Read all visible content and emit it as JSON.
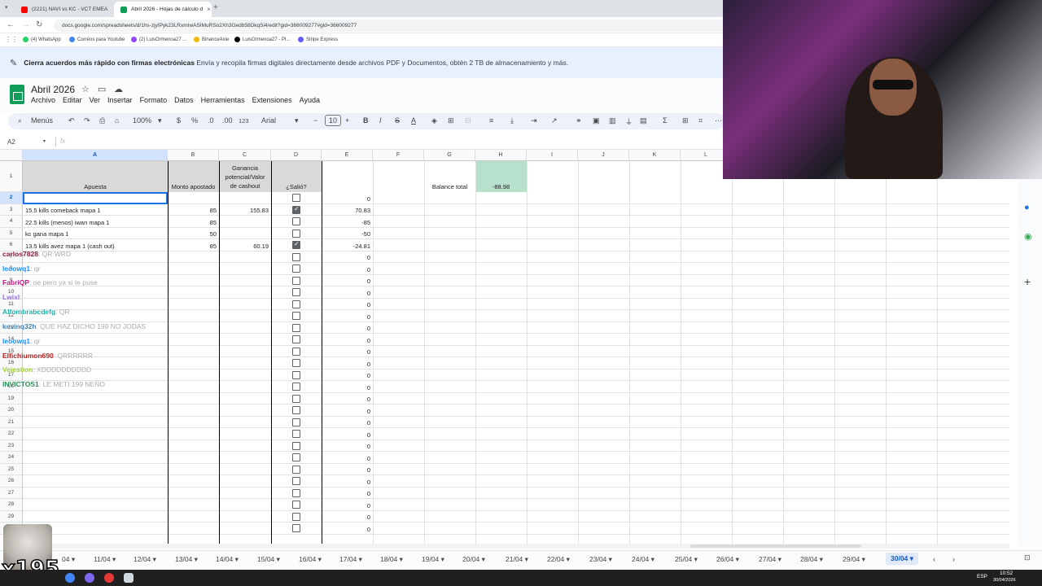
{
  "browser": {
    "tabs": [
      {
        "label": "(2221) NAVI vs KC - VCT EMEA",
        "icon": "youtube-icon",
        "color": "#ff0000"
      },
      {
        "label": "Abril 2026 - Hojas de cálculo d",
        "icon": "sheets-icon",
        "color": "#0f9d58"
      }
    ],
    "url": "docs.google.com/spreadsheets/d/1hs-zjyIPyk23LRxmIwASIMuRSo2Xh3Gedb58DkqSi4/edit?gid=366009277#gid=366009277",
    "bookmarks": [
      "(4) WhatsApp",
      "Correos para Youtube",
      "(2) LuisOrmenoa27 ...",
      "BinanceAxie",
      "LuisOrmenoa27 - Pl...",
      "Stripe Express"
    ]
  },
  "promo": {
    "bold": "Cierra acuerdos más rápido con firmas electrónicas",
    "text": "Envía y recopila firmas digitales directamente desde archivos PDF y Documentos, obtén 2 TB de almacenamiento y más."
  },
  "doc": {
    "title": "Abril 2026",
    "menus": [
      "Archivo",
      "Editar",
      "Ver",
      "Insertar",
      "Formato",
      "Datos",
      "Herramientas",
      "Extensiones",
      "Ayuda"
    ]
  },
  "toolbar": {
    "menus_label": "Menús",
    "zoom": "100%",
    "currency": "$",
    "percent": "%",
    "dec_down": ".0",
    "dec_up": ".00",
    "format_123": "123",
    "font": "Arial",
    "font_size": "10"
  },
  "formula_bar": {
    "cell_ref": "A2",
    "fx": "fx",
    "value": ""
  },
  "columns": [
    "A",
    "B",
    "C",
    "D",
    "E",
    "F",
    "G",
    "H",
    "I",
    "J",
    "K",
    "L"
  ],
  "header_row": {
    "apuesta": "Apuesta",
    "monto": "Monto apostado",
    "ganancia": "Ganancia potencial/Valor de cashout",
    "salio": "¿Salió?",
    "balance_label": "Balance total",
    "balance_value": "-88.98"
  },
  "rows": [
    {
      "num": "2",
      "apuesta": "",
      "monto": "",
      "ganancia": "",
      "checked": false,
      "e": "0"
    },
    {
      "num": "3",
      "apuesta": "15.5 kills comeback mapa 1",
      "monto": "85",
      "ganancia": "155.83",
      "checked": true,
      "e": "70.83"
    },
    {
      "num": "4",
      "apuesta": "22.5 kills (menos) iwan mapa 1",
      "monto": "85",
      "ganancia": "",
      "checked": false,
      "e": "-85"
    },
    {
      "num": "5",
      "apuesta": "kc gana mapa 1",
      "monto": "50",
      "ganancia": "",
      "checked": false,
      "e": "-50"
    },
    {
      "num": "6",
      "apuesta": "13.5 kills avez mapa 1 (cash out)",
      "monto": "85",
      "ganancia": "60.19",
      "checked": true,
      "e": "-24.81"
    }
  ],
  "empty_row_numbers": [
    "7",
    "8",
    "9",
    "10",
    "11",
    "12",
    "13",
    "14",
    "15",
    "16",
    "17",
    "18",
    "19",
    "20",
    "21",
    "22",
    "23",
    "24",
    "25",
    "26",
    "27",
    "28",
    "29",
    "30"
  ],
  "empty_row_value": "0",
  "chat": [
    {
      "user": "carlos7828",
      "msg": ": QR WRD",
      "color": "#8b1a3a"
    },
    {
      "user": "leoowq1",
      "msg": ": qr",
      "color": "#1e90ff"
    },
    {
      "user": "FabriQP",
      "msg": ": oe pero ya si te puse",
      "color": "#c71585"
    },
    {
      "user": "Lwixl",
      "msg": ": ",
      "color": "#9370db"
    },
    {
      "user": "Alfombrabcdefg",
      "msg": ": QR",
      "color": "#20b2aa"
    },
    {
      "user": "kevinq32h",
      "msg": ": QUE HAZ DICHO 199 NO JODAS",
      "color": "#4682b4"
    },
    {
      "user": "leoowq1",
      "msg": ": qr",
      "color": "#1e90ff"
    },
    {
      "user": "Elfichiumon690",
      "msg": ": QRRRRRR",
      "color": "#b22222"
    },
    {
      "user": "Vejestion",
      "msg": ": XDDDDDDDDDD",
      "color": "#9acd32"
    },
    {
      "user": "INVICTOS1",
      "msg": ": LE METI 199 NEÑO",
      "color": "#2e8b57"
    }
  ],
  "sheet_tabs": [
    "04",
    "11/04",
    "12/04",
    "13/04",
    "14/04",
    "15/04",
    "16/04",
    "17/04",
    "18/04",
    "19/04",
    "20/04",
    "21/04",
    "22/04",
    "23/04",
    "24/04",
    "25/04",
    "26/04",
    "27/04",
    "28/04",
    "29/04",
    "30/04"
  ],
  "active_sheet": "30/04",
  "emote_count": "x195",
  "taskbar": {
    "lang": "ESP",
    "time": "10:52",
    "date": "30/04/2026"
  },
  "colors": {
    "accent": "#1a73e8",
    "balance_bg": "#b7e1cd",
    "header_bg": "#d9d9d9",
    "promo_bg": "#e8f0fe"
  }
}
